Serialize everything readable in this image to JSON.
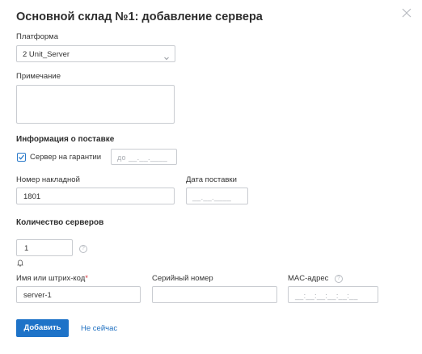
{
  "dialog": {
    "title": "Основной склад №1: добавление сервера"
  },
  "platform": {
    "label": "Платформа",
    "value": "2 Unit_Server"
  },
  "note": {
    "label": "Примечание",
    "value": ""
  },
  "supply": {
    "heading": "Информация о поставке",
    "warranty_label": "Сервер на гарантии",
    "warranty_checked": true,
    "warranty_prefix": "до",
    "warranty_date_mask": "__.__.____",
    "invoice_label": "Номер накладной",
    "invoice_value": "1801",
    "date_label": "Дата поставки",
    "date_mask": "__.__.____"
  },
  "servers": {
    "heading": "Количество серверов",
    "count": "1",
    "name_label": "Имя или штрих-код",
    "name_required_mark": "*",
    "name_value": "server-1",
    "serial_label": "Серийный номер",
    "serial_value": "",
    "mac_label": "MAC-адрес",
    "mac_mask": "__:__:__:__:__:__"
  },
  "actions": {
    "add_label": "Добавить",
    "later_label": "Не сейчас"
  },
  "colors": {
    "accent": "#1e73c8",
    "required": "#d9363e",
    "border": "#c9ccd1"
  }
}
